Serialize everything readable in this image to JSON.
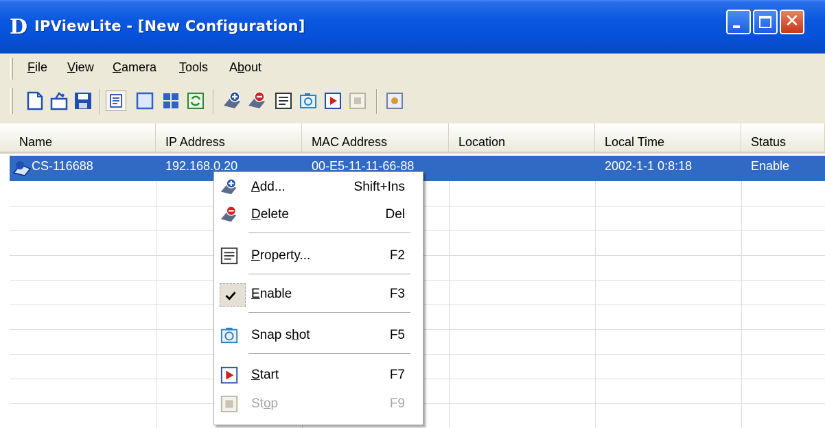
{
  "window": {
    "logo": "D",
    "title": "IPViewLite - [New Configuration]",
    "minimize_icon": "minimize-icon",
    "maximize_icon": "maximize-icon",
    "close_icon": "close-icon"
  },
  "menubar": {
    "items": [
      {
        "label": "File",
        "accel": "F",
        "rest": "ile"
      },
      {
        "label": "View",
        "accel": "V",
        "rest": "iew"
      },
      {
        "label": "Camera",
        "accel": "C",
        "rest": "amera"
      },
      {
        "label": "Tools",
        "accel": "T",
        "rest": "ools"
      },
      {
        "label": "About",
        "pre": "A",
        "accel": "b",
        "rest": "out"
      }
    ]
  },
  "toolbar": {
    "buttons": [
      "new-icon",
      "open-icon",
      "save-icon",
      "list-view-icon",
      "single-view-icon",
      "quad-view-icon",
      "refresh-icon",
      "add-camera-icon",
      "delete-camera-icon",
      "property-icon",
      "snapshot-icon",
      "start-icon",
      "stop-icon",
      "settings-icon"
    ]
  },
  "list": {
    "columns": [
      "Name",
      "IP Address",
      "MAC Address",
      "Location",
      "Local Time",
      "Status"
    ],
    "rows": [
      {
        "name": "CS-116688",
        "ip": "192.168.0.20",
        "mac": "00-E5-11-11-66-88",
        "location": "",
        "local_time": "2002-1-1  0:8:18",
        "status": "Enable"
      }
    ]
  },
  "context_menu": {
    "items": [
      {
        "accel": "A",
        "rest": "dd...",
        "shortcut": "Shift+Ins",
        "icon": "add-camera-icon",
        "enabled": true
      },
      {
        "accel": "D",
        "rest": "elete",
        "shortcut": "Del",
        "icon": "delete-camera-icon",
        "enabled": true
      },
      {
        "accel": "P",
        "rest": "roperty...",
        "shortcut": "F2",
        "icon": "property-icon",
        "enabled": true
      },
      {
        "accel": "E",
        "rest": "nable",
        "shortcut": "F3",
        "icon": "check-icon",
        "enabled": true,
        "checked": true
      },
      {
        "pre": "Snap s",
        "accel": "h",
        "rest": "ot",
        "shortcut": "F5",
        "icon": "snapshot-icon",
        "enabled": true
      },
      {
        "accel": "S",
        "rest": "tart",
        "shortcut": "F7",
        "icon": "start-icon",
        "enabled": true
      },
      {
        "pre": "St",
        "accel": "o",
        "rest": "p",
        "shortcut": "F9",
        "icon": "stop-icon",
        "enabled": false
      }
    ]
  }
}
